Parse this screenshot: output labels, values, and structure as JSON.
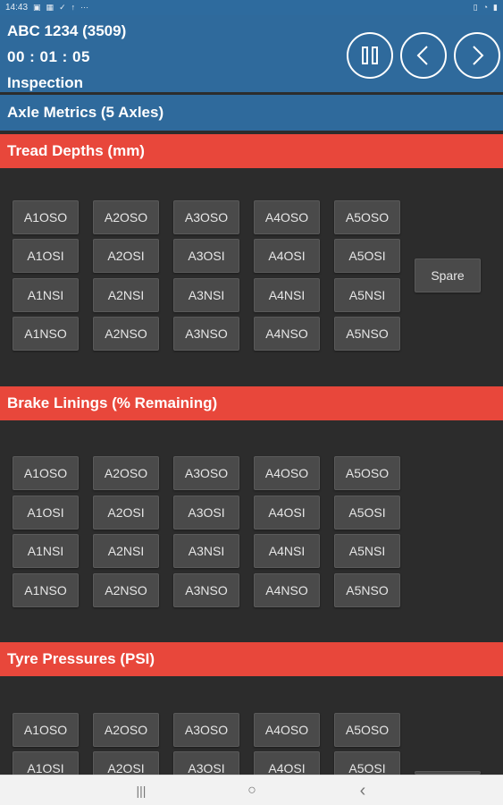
{
  "status_bar": {
    "time": "14:43",
    "left_icons": [
      "image-icon",
      "gallery-icon",
      "check-icon",
      "upload-icon",
      "more-icon"
    ],
    "right_icons": [
      "vibrate-icon",
      "wifi-icon",
      "battery-icon"
    ]
  },
  "header": {
    "registration": "ABC 1234 (3509)",
    "timer": "00 : 01 : 05",
    "mode": "Inspection"
  },
  "axle_metrics": "Axle Metrics (5 Axles)",
  "sections": {
    "tread": {
      "title": "Tread Depths (mm)",
      "rows": [
        [
          "A1OSO",
          "A2OSO",
          "A3OSO",
          "A4OSO",
          "A5OSO"
        ],
        [
          "A1OSI",
          "A2OSI",
          "A3OSI",
          "A4OSI",
          "A5OSI"
        ],
        [
          "A1NSI",
          "A2NSI",
          "A3NSI",
          "A4NSI",
          "A5NSI"
        ],
        [
          "A1NSO",
          "A2NSO",
          "A3NSO",
          "A4NSO",
          "A5NSO"
        ]
      ],
      "spare": "Spare"
    },
    "brake": {
      "title": "Brake Linings (% Remaining)",
      "rows": [
        [
          "A1OSO",
          "A2OSO",
          "A3OSO",
          "A4OSO",
          "A5OSO"
        ],
        [
          "A1OSI",
          "A2OSI",
          "A3OSI",
          "A4OSI",
          "A5OSI"
        ],
        [
          "A1NSI",
          "A2NSI",
          "A3NSI",
          "A4NSI",
          "A5NSI"
        ],
        [
          "A1NSO",
          "A2NSO",
          "A3NSO",
          "A4NSO",
          "A5NSO"
        ]
      ]
    },
    "tyre": {
      "title": "Tyre Pressures (PSI)",
      "rows": [
        [
          "A1OSO",
          "A2OSO",
          "A3OSO",
          "A4OSO",
          "A5OSO"
        ],
        [
          "A1OSI",
          "A2OSI",
          "A3OSI",
          "A4OSI",
          "A5OSI"
        ]
      ]
    }
  },
  "nav_bar": {
    "recent": "|||",
    "home": "○",
    "back": "‹"
  }
}
